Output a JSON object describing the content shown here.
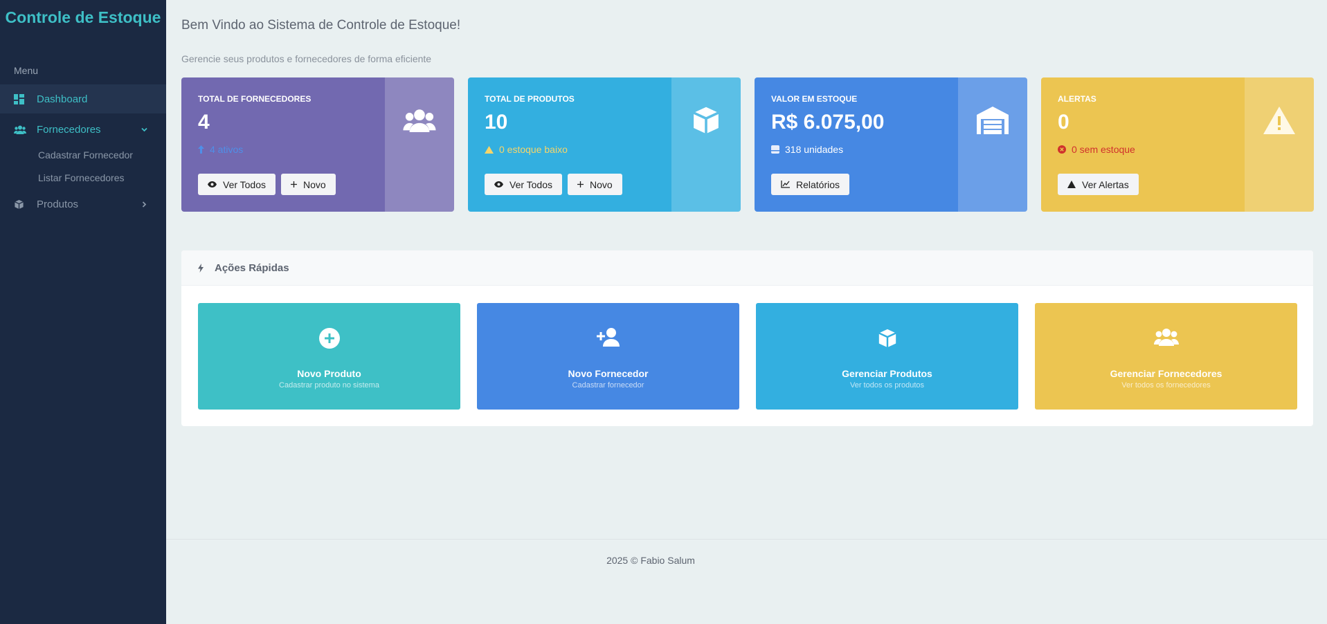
{
  "colors": {
    "sidebar_bg": "#1b2942",
    "accent": "#3ebfc6",
    "purple": "#7269b0",
    "cyan": "#33afe0",
    "blue": "#4688e3",
    "yellow": "#ecc551",
    "teal": "#3ec0c6"
  },
  "sidebar": {
    "brand": "Controle de Estoque",
    "menu_label": "Menu",
    "items": [
      {
        "label": "Dashboard",
        "icon": "dashboard-icon"
      },
      {
        "label": "Fornecedores",
        "icon": "users-icon"
      },
      {
        "label": "Produtos",
        "icon": "box-icon"
      }
    ],
    "sub_items": [
      "Cadastrar Fornecedor",
      "Listar Fornecedores"
    ]
  },
  "header": {
    "title": "Bem Vindo ao Sistema de Controle de Estoque!",
    "subtitle": "Gerencie seus produtos e fornecedores de forma eficiente"
  },
  "stats": [
    {
      "title": "TOTAL DE FORNECEDORES",
      "value": "4",
      "note": "4 ativos",
      "buttons": [
        "Ver Todos",
        "Novo"
      ],
      "icon": "users-icon"
    },
    {
      "title": "TOTAL DE PRODUTOS",
      "value": "10",
      "note": "0 estoque baixo",
      "buttons": [
        "Ver Todos",
        "Novo"
      ],
      "icon": "box-icon"
    },
    {
      "title": "VALOR EM ESTOQUE",
      "value": "R$ 6.075,00",
      "note": "318 unidades",
      "buttons": [
        "Relatórios"
      ],
      "icon": "warehouse-icon"
    },
    {
      "title": "ALERTAS",
      "value": "0",
      "note": "0 sem estoque",
      "buttons": [
        "Ver Alertas"
      ],
      "icon": "warning-icon"
    }
  ],
  "quick_actions": {
    "title": "Ações Rápidas",
    "tiles": [
      {
        "title": "Novo Produto",
        "subtitle": "Cadastrar produto no sistema",
        "icon": "plus-circle-icon"
      },
      {
        "title": "Novo Fornecedor",
        "subtitle": "Cadastrar fornecedor",
        "icon": "user-plus-icon"
      },
      {
        "title": "Gerenciar Produtos",
        "subtitle": "Ver todos os produtos",
        "icon": "box-icon"
      },
      {
        "title": "Gerenciar Fornecedores",
        "subtitle": "Ver todos os fornecedores",
        "icon": "users-icon"
      }
    ]
  },
  "footer": {
    "text": "2025 © Fabio Salum"
  }
}
